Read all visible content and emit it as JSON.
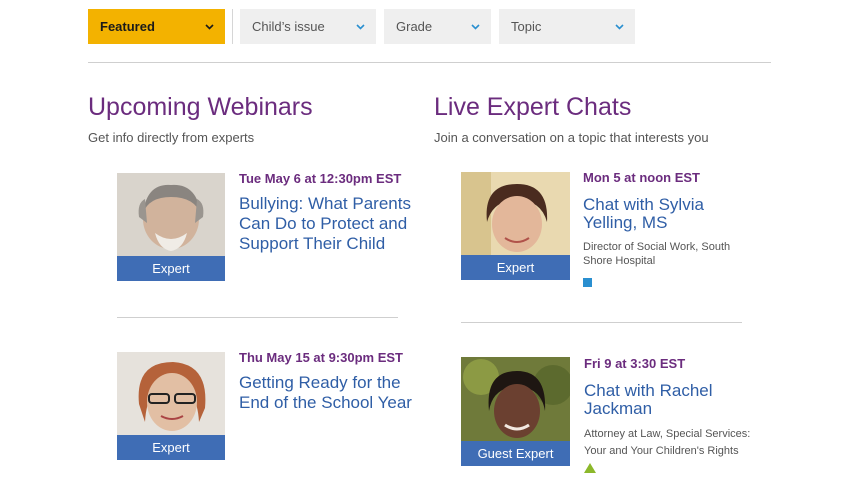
{
  "filters": {
    "featured": "Featured",
    "childs_issue": "Child’s issue",
    "grade": "Grade",
    "topic": "Topic"
  },
  "webinars": {
    "title": "Upcoming Webinars",
    "subtitle": "Get info directly from experts",
    "items": [
      {
        "date": "Tue May 6 at 12:30pm EST",
        "title": "Bullying: What Parents Can Do to Protect and Support Their Child",
        "badge": "Expert"
      },
      {
        "date": "Thu May 15 at 9:30pm EST",
        "title": "Getting Ready for the End of the School Year",
        "badge": "Expert"
      }
    ]
  },
  "chats": {
    "title": "Live Expert Chats",
    "subtitle": "Join a conversation on a topic that interests you",
    "items": [
      {
        "date": "Mon 5 at noon EST",
        "title": "Chat with  Sylvia Yelling, MS",
        "role": "Director of Social Work, South Shore Hospital",
        "badge": "Expert",
        "icon": "square-icon"
      },
      {
        "date": "Fri 9 at 3:30 EST",
        "title": "Chat with Rachel Jackman",
        "role": "Attorney at Law, Special Services: Your and Your Children's Rights",
        "badge": "Guest Expert",
        "icon": "triangle-icon"
      }
    ]
  },
  "colors": {
    "accent_purple": "#6b2c7e",
    "link_blue": "#2f5ea6",
    "badge_blue": "#3f6db5",
    "featured_yellow": "#f3b200",
    "square_blue": "#2a8fd0",
    "triangle_green": "#8cb82b"
  }
}
